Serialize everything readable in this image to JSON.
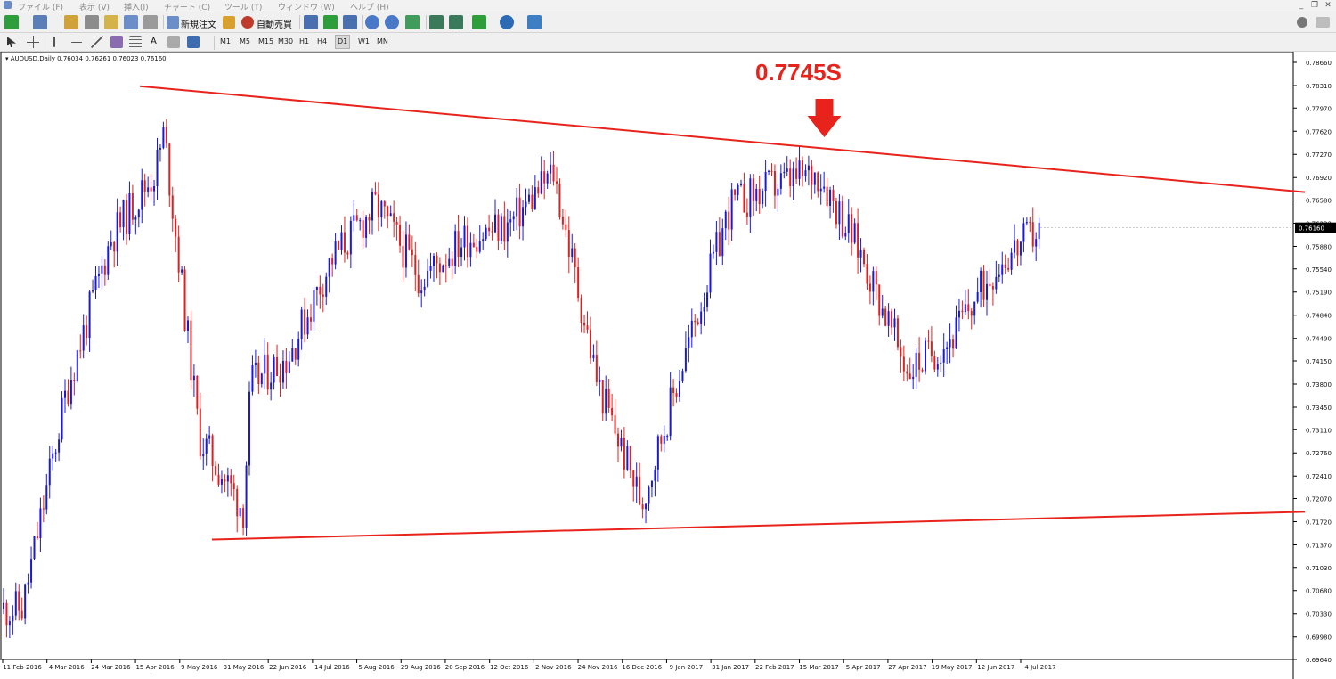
{
  "menubar": {
    "items": [
      "ファイル (F)",
      "表示 (V)",
      "挿入(I)",
      "チャート (C)",
      "ツール (T)",
      "ウィンドウ (W)",
      "ヘルプ (H)"
    ]
  },
  "toolbar": {
    "new_order_label": "新規注文",
    "auto_trading_label": "自動売買",
    "timeframes": [
      "M1",
      "M5",
      "M15",
      "M30",
      "H1",
      "H4",
      "D1",
      "W1",
      "MN"
    ],
    "active_timeframe": "D1"
  },
  "chart": {
    "symbol_info": "AUDUSD,Daily  0.76034 0.76261 0.76023 0.76160",
    "annotation": "0.7745S",
    "current_price_label": "0.76160",
    "colors": {
      "bull": "#1a1ad6",
      "bear": "#e02020",
      "trendline": "#e8231c"
    }
  },
  "chart_data": {
    "type": "candlestick",
    "symbol": "AUDUSD",
    "timeframe": "Daily",
    "ohlc_last": {
      "open": 0.76034,
      "high": 0.76261,
      "low": 0.76023,
      "close": 0.7616
    },
    "y_ticks": [
      0.7866,
      0.7831,
      0.7797,
      0.7762,
      0.7727,
      0.7692,
      0.7658,
      0.7623,
      0.7588,
      0.7554,
      0.7519,
      0.7484,
      0.7449,
      0.7415,
      0.738,
      0.7345,
      0.7311,
      0.7276,
      0.7241,
      0.7207,
      0.7172,
      0.7137,
      0.7103,
      0.7068,
      0.7033,
      0.6998,
      0.6964
    ],
    "x_ticks": [
      "11 Feb 2016",
      "4 Mar 2016",
      "24 Mar 2016",
      "15 Apr 2016",
      "9 May 2016",
      "31 May 2016",
      "22 Jun 2016",
      "14 Jul 2016",
      "5 Aug 2016",
      "29 Aug 2016",
      "20 Sep 2016",
      "12 Oct 2016",
      "2 Nov 2016",
      "24 Nov 2016",
      "16 Dec 2016",
      "9 Jan 2017",
      "31 Jan 2017",
      "22 Feb 2017",
      "15 Mar 2017",
      "5 Apr 2017",
      "27 Apr 2017",
      "19 May 2017",
      "12 Jun 2017",
      "4 Jul 2017"
    ],
    "ylim": [
      0.6955,
      0.7875
    ],
    "approx_close_path": [
      [
        "11 Feb 2016",
        0.704
      ],
      [
        "4 Mar 2016",
        0.737
      ],
      [
        "24 Mar 2016",
        0.76
      ],
      [
        "15 Apr 2016",
        0.77
      ],
      [
        "21 Apr 2016",
        0.776
      ],
      [
        "9 May 2016",
        0.73
      ],
      [
        "31 May 2016",
        0.719
      ],
      [
        "6 Jun 2016",
        0.738
      ],
      [
        "22 Jun 2016",
        0.742
      ],
      [
        "14 Jul 2016",
        0.757
      ],
      [
        "5 Aug 2016",
        0.765
      ],
      [
        "29 Aug 2016",
        0.754
      ],
      [
        "20 Sep 2016",
        0.76
      ],
      [
        "12 Oct 2016",
        0.762
      ],
      [
        "2 Nov 2016",
        0.77
      ],
      [
        "24 Nov 2016",
        0.738
      ],
      [
        "16 Dec 2016",
        0.72
      ],
      [
        "9 Jan 2017",
        0.743
      ],
      [
        "31 Jan 2017",
        0.765
      ],
      [
        "22 Feb 2017",
        0.768
      ],
      [
        "15 Mar 2017",
        0.77
      ],
      [
        "5 Apr 2017",
        0.757
      ],
      [
        "27 Apr 2017",
        0.74
      ],
      [
        "19 May 2017",
        0.745
      ],
      [
        "12 Jun 2017",
        0.756
      ],
      [
        "4 Jul 2017",
        0.7616
      ]
    ],
    "trendlines": [
      {
        "from": [
          "15 Apr 2016",
          0.783
        ],
        "to": [
          "4 Jul 2017",
          0.7672
        ]
      },
      {
        "from": [
          "31 May 2016",
          0.7145
        ],
        "to": [
          "4 Jul 2017",
          0.7185
        ]
      }
    ],
    "annotations": [
      {
        "text": "0.7745S",
        "date": "15 Mar 2017",
        "price": 0.7745
      }
    ]
  }
}
